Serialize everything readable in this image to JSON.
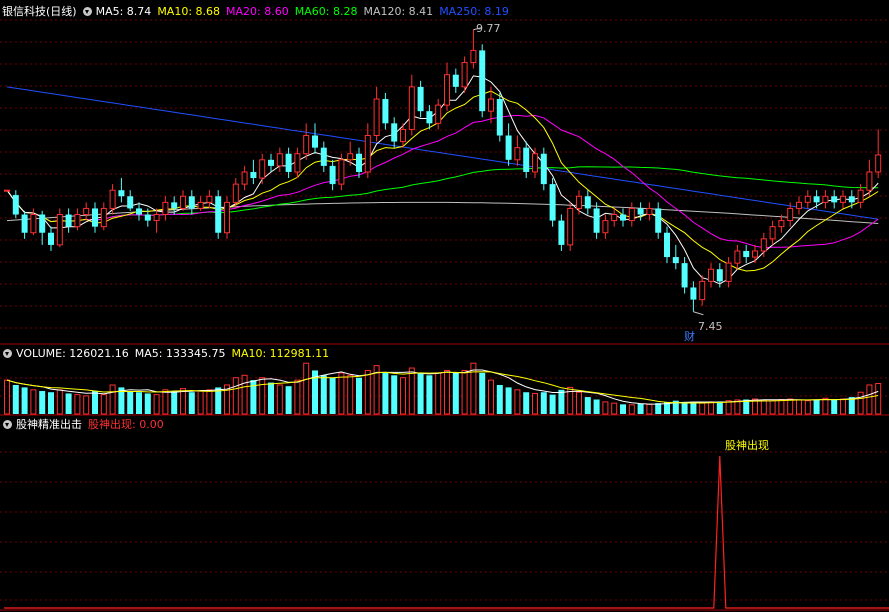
{
  "header_main": {
    "title": "银信科技(日线)",
    "ma": [
      {
        "label": "MA5: 8.74",
        "color": "#ffffff"
      },
      {
        "label": "MA10: 8.68",
        "color": "#ffff00"
      },
      {
        "label": "MA20: 8.60",
        "color": "#ff00ff"
      },
      {
        "label": "MA60: 8.28",
        "color": "#00ff00"
      },
      {
        "label": "MA120: 8.41",
        "color": "#c0c0c0"
      },
      {
        "label": "MA250: 8.19",
        "color": "#2050ff"
      }
    ]
  },
  "header_volume": {
    "title": "VOLUME: 126021.16",
    "ma5": "MA5: 133345.75",
    "ma10": "MA10: 112981.11",
    "title_color": "#ffffff",
    "ma5_color": "#ffffff",
    "ma10_color": "#ffff00"
  },
  "header_indicator": {
    "title": "股神精准出击",
    "value": "股神出现: 0.00",
    "value_color": "#ff3030"
  },
  "annotations": {
    "high_label": "9.77",
    "low_label": "7.45",
    "fin_marker": "财",
    "signal_label": "股神出现"
  },
  "colors": {
    "up": "#ff3030",
    "down": "#54ffff",
    "grid": "#700000",
    "separator": "#a00000",
    "signal": "#ff2020",
    "ma5": "#ffffff",
    "ma10": "#ffff00",
    "ma20": "#ff00ff",
    "ma60": "#00ff00",
    "ma120": "#c0c0c0",
    "ma250": "#2050ff"
  },
  "chart_data": {
    "type": "candlestick",
    "price_ylim": [
      7.3,
      9.85
    ],
    "high": 9.77,
    "low": 7.45,
    "signal_index": 81,
    "candles": [
      [
        8.45,
        8.45,
        8.45,
        8.45
      ],
      [
        8.41,
        8.25,
        8.45,
        8.22
      ],
      [
        8.25,
        8.1,
        8.28,
        8.05
      ],
      [
        8.1,
        8.25,
        8.3,
        8.08
      ],
      [
        8.25,
        8.1,
        8.28,
        8.0
      ],
      [
        8.1,
        8.0,
        8.15,
        7.95
      ],
      [
        8.0,
        8.25,
        8.3,
        7.98
      ],
      [
        8.25,
        8.15,
        8.3,
        8.1
      ],
      [
        8.15,
        8.25,
        8.3,
        8.12
      ],
      [
        8.25,
        8.3,
        8.35,
        8.2
      ],
      [
        8.3,
        8.15,
        8.35,
        8.1
      ],
      [
        8.15,
        8.3,
        8.35,
        8.12
      ],
      [
        8.3,
        8.45,
        8.5,
        8.25
      ],
      [
        8.45,
        8.4,
        8.55,
        8.35
      ],
      [
        8.4,
        8.3,
        8.45,
        8.28
      ],
      [
        8.3,
        8.25,
        8.35,
        8.2
      ],
      [
        8.25,
        8.2,
        8.3,
        8.15
      ],
      [
        8.2,
        8.25,
        8.3,
        8.1
      ],
      [
        8.25,
        8.35,
        8.4,
        8.2
      ],
      [
        8.35,
        8.3,
        8.4,
        8.25
      ],
      [
        8.3,
        8.4,
        8.45,
        8.28
      ],
      [
        8.4,
        8.3,
        8.45,
        8.25
      ],
      [
        8.3,
        8.35,
        8.4,
        8.28
      ],
      [
        8.35,
        8.4,
        8.45,
        8.3
      ],
      [
        8.4,
        8.1,
        8.45,
        8.05
      ],
      [
        8.1,
        8.35,
        8.4,
        8.05
      ],
      [
        8.35,
        8.5,
        8.55,
        8.3
      ],
      [
        8.5,
        8.6,
        8.65,
        8.45
      ],
      [
        8.6,
        8.55,
        8.7,
        8.5
      ],
      [
        8.55,
        8.7,
        8.75,
        8.5
      ],
      [
        8.7,
        8.65,
        8.75,
        8.6
      ],
      [
        8.65,
        8.75,
        8.8,
        8.6
      ],
      [
        8.75,
        8.6,
        8.8,
        8.55
      ],
      [
        8.6,
        8.75,
        8.8,
        8.55
      ],
      [
        8.75,
        8.9,
        9.0,
        8.7
      ],
      [
        8.9,
        8.8,
        9.0,
        8.75
      ],
      [
        8.8,
        8.65,
        8.85,
        8.6
      ],
      [
        8.65,
        8.5,
        8.7,
        8.45
      ],
      [
        8.5,
        8.7,
        8.75,
        8.45
      ],
      [
        8.7,
        8.75,
        8.85,
        8.65
      ],
      [
        8.75,
        8.6,
        8.8,
        8.55
      ],
      [
        8.6,
        8.9,
        9.0,
        8.55
      ],
      [
        8.9,
        9.2,
        9.3,
        8.85
      ],
      [
        9.2,
        9.0,
        9.25,
        8.95
      ],
      [
        9.0,
        8.85,
        9.05,
        8.8
      ],
      [
        8.85,
        8.95,
        9.0,
        8.8
      ],
      [
        8.95,
        9.3,
        9.4,
        8.9
      ],
      [
        9.3,
        9.1,
        9.35,
        9.05
      ],
      [
        9.1,
        9.0,
        9.15,
        8.95
      ],
      [
        9.0,
        9.15,
        9.2,
        8.95
      ],
      [
        9.15,
        9.4,
        9.5,
        9.1
      ],
      [
        9.4,
        9.3,
        9.45,
        9.25
      ],
      [
        9.3,
        9.5,
        9.55,
        9.25
      ],
      [
        9.5,
        9.6,
        9.77,
        9.45
      ],
      [
        9.6,
        9.1,
        9.65,
        9.05
      ],
      [
        9.1,
        9.2,
        9.3,
        9.0
      ],
      [
        9.2,
        8.9,
        9.25,
        8.85
      ],
      [
        8.9,
        8.7,
        9.0,
        8.65
      ],
      [
        8.7,
        8.8,
        8.9,
        8.65
      ],
      [
        8.8,
        8.6,
        8.85,
        8.55
      ],
      [
        8.6,
        8.75,
        8.8,
        8.55
      ],
      [
        8.75,
        8.5,
        8.8,
        8.45
      ],
      [
        8.5,
        8.2,
        8.55,
        8.15
      ],
      [
        8.2,
        8.0,
        8.25,
        7.95
      ],
      [
        8.0,
        8.3,
        8.35,
        7.95
      ],
      [
        8.3,
        8.4,
        8.45,
        8.25
      ],
      [
        8.4,
        8.3,
        8.45,
        8.25
      ],
      [
        8.3,
        8.1,
        8.35,
        8.05
      ],
      [
        8.1,
        8.2,
        8.25,
        8.05
      ],
      [
        8.2,
        8.25,
        8.3,
        8.15
      ],
      [
        8.25,
        8.2,
        8.3,
        8.15
      ],
      [
        8.2,
        8.3,
        8.35,
        8.15
      ],
      [
        8.3,
        8.25,
        8.35,
        8.2
      ],
      [
        8.25,
        8.3,
        8.35,
        8.2
      ],
      [
        8.3,
        8.1,
        8.35,
        8.05
      ],
      [
        8.1,
        7.9,
        8.15,
        7.85
      ],
      [
        7.9,
        7.85,
        8.0,
        7.8
      ],
      [
        7.85,
        7.65,
        7.9,
        7.6
      ],
      [
        7.65,
        7.55,
        7.7,
        7.45
      ],
      [
        7.55,
        7.7,
        7.75,
        7.5
      ],
      [
        7.7,
        7.8,
        7.85,
        7.65
      ],
      [
        7.8,
        7.7,
        7.85,
        7.65
      ],
      [
        7.7,
        7.85,
        7.9,
        7.65
      ],
      [
        7.85,
        7.95,
        8.0,
        7.8
      ],
      [
        7.95,
        7.9,
        8.0,
        7.85
      ],
      [
        7.9,
        7.95,
        8.0,
        7.85
      ],
      [
        7.95,
        8.05,
        8.1,
        7.9
      ],
      [
        8.05,
        8.15,
        8.2,
        8.0
      ],
      [
        8.15,
        8.2,
        8.25,
        8.1
      ],
      [
        8.2,
        8.3,
        8.35,
        8.15
      ],
      [
        8.3,
        8.35,
        8.4,
        8.25
      ],
      [
        8.35,
        8.4,
        8.45,
        8.3
      ],
      [
        8.4,
        8.35,
        8.45,
        8.3
      ],
      [
        8.35,
        8.4,
        8.45,
        8.3
      ],
      [
        8.4,
        8.35,
        8.45,
        8.3
      ],
      [
        8.35,
        8.4,
        8.45,
        8.3
      ],
      [
        8.4,
        8.35,
        8.45,
        8.3
      ],
      [
        8.35,
        8.45,
        8.5,
        8.3
      ],
      [
        8.45,
        8.6,
        8.7,
        8.4
      ],
      [
        8.6,
        8.74,
        8.95,
        8.55
      ]
    ],
    "volume": [
      140000,
      120000,
      110000,
      100000,
      95000,
      90000,
      100000,
      85000,
      80000,
      75000,
      95000,
      80000,
      120000,
      110000,
      95000,
      90000,
      85000,
      80000,
      100000,
      95000,
      105000,
      90000,
      95000,
      100000,
      110000,
      120000,
      150000,
      160000,
      140000,
      150000,
      130000,
      120000,
      115000,
      140000,
      210000,
      180000,
      160000,
      150000,
      170000,
      160000,
      150000,
      180000,
      200000,
      170000,
      160000,
      150000,
      190000,
      170000,
      160000,
      170000,
      180000,
      170000,
      180000,
      210000,
      170000,
      140000,
      120000,
      110000,
      100000,
      90000,
      85000,
      90000,
      80000,
      100000,
      110000,
      90000,
      70000,
      60000,
      50000,
      45000,
      40000,
      38000,
      42000,
      40000,
      45000,
      50000,
      55000,
      50000,
      48000,
      45000,
      50000,
      52000,
      55000,
      58000,
      60000,
      62000,
      58000,
      55000,
      60000,
      62000,
      58000,
      55000,
      60000,
      65000,
      60000,
      62000,
      70000,
      90000,
      120000,
      126021
    ]
  }
}
